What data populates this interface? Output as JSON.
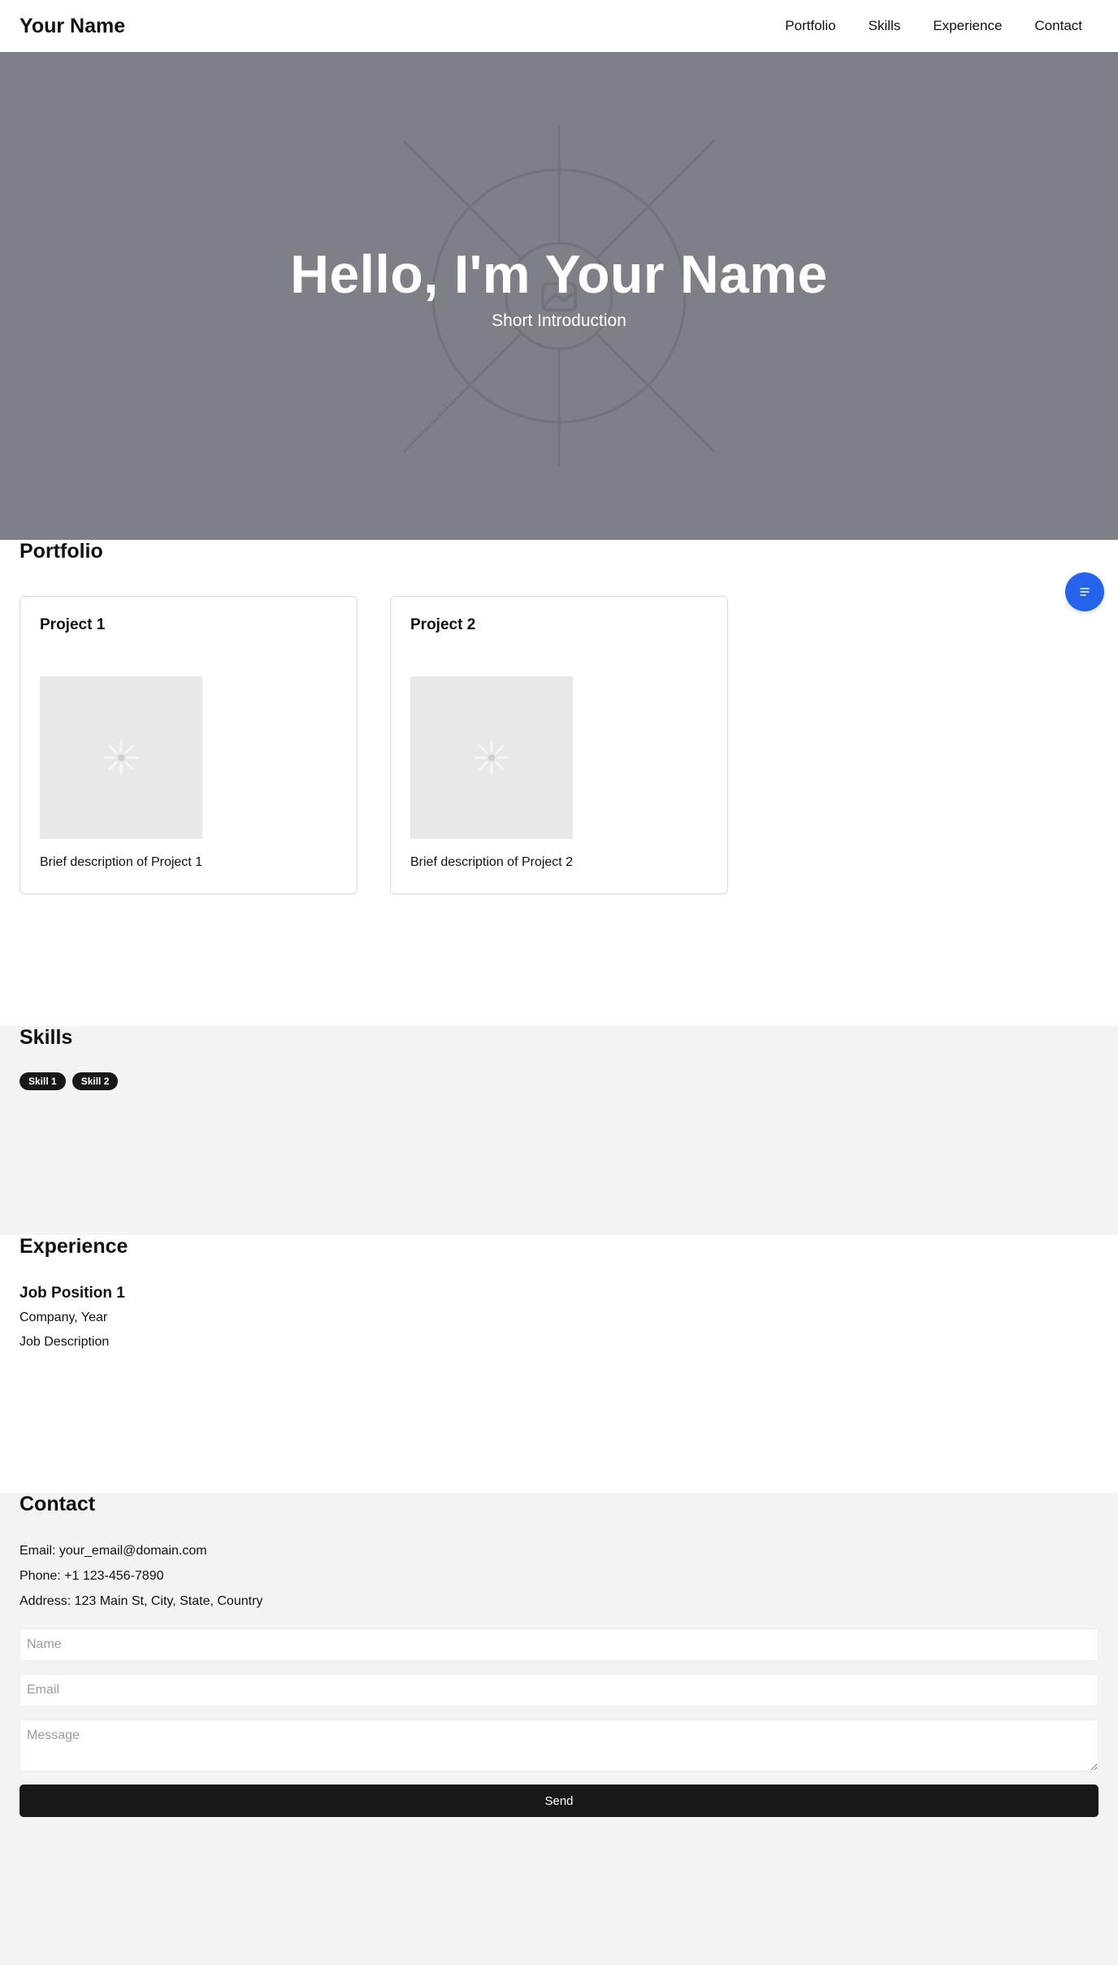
{
  "header": {
    "brand": "Your Name",
    "nav": [
      "Portfolio",
      "Skills",
      "Experience",
      "Contact"
    ]
  },
  "hero": {
    "title": "Hello, I'm Your Name",
    "subtitle": "Short Introduction",
    "background_icon": "image-placeholder-icon"
  },
  "fab": {
    "icon": "menu-lines-icon",
    "color": "#2563eb"
  },
  "portfolio": {
    "title": "Portfolio",
    "projects": [
      {
        "title": "Project 1",
        "description": "Brief description of Project 1",
        "image_icon": "loading-spinner-icon"
      },
      {
        "title": "Project 2",
        "description": "Brief description of Project 2",
        "image_icon": "loading-spinner-icon"
      }
    ]
  },
  "skills": {
    "title": "Skills",
    "items": [
      "Skill 1",
      "Skill 2"
    ]
  },
  "experience": {
    "title": "Experience",
    "jobs": [
      {
        "position": "Job Position 1",
        "company_year": "Company, Year",
        "description": "Job Description"
      }
    ]
  },
  "contact": {
    "title": "Contact",
    "email": "Email: your_email@domain.com",
    "phone": "Phone: +1 123-456-7890",
    "address": "Address: 123 Main St, City, State, Country",
    "form": {
      "name_placeholder": "Name",
      "email_placeholder": "Email",
      "message_placeholder": "Message",
      "send_label": "Send"
    }
  }
}
